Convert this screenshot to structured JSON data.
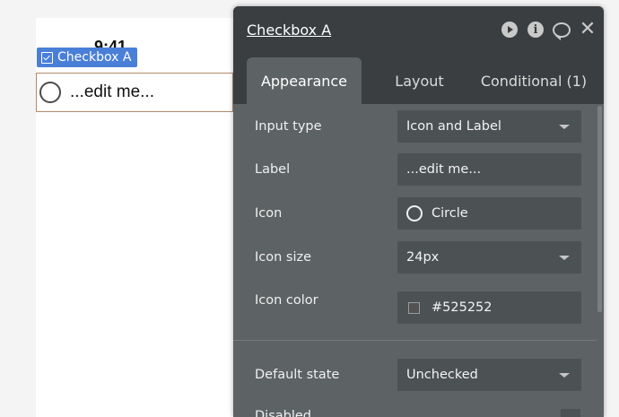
{
  "canvas": {
    "time": "9:41",
    "element_tag": "Checkbox A",
    "checkbox_label": "...edit me..."
  },
  "panel": {
    "title": "Checkbox A",
    "tabs": [
      {
        "label": "Appearance",
        "active": true
      },
      {
        "label": "Layout",
        "active": false
      },
      {
        "label": "Conditional (1)",
        "active": false
      }
    ],
    "fields": {
      "input_type": {
        "label": "Input type",
        "value": "Icon and Label"
      },
      "label": {
        "label": "Label",
        "value": "...edit me..."
      },
      "icon": {
        "label": "Icon",
        "value": "Circle"
      },
      "icon_size": {
        "label": "Icon size",
        "value": "24px"
      },
      "icon_color": {
        "label": "Icon color",
        "value": "#525252"
      },
      "default_state": {
        "label": "Default state",
        "value": "Unchecked"
      },
      "disabled": {
        "label": "Disabled"
      }
    }
  },
  "icons": [
    "checkbox-icon",
    "play-icon",
    "info-icon",
    "comment-icon",
    "close-icon",
    "circle-icon",
    "chevron-down-icon"
  ],
  "colors": {
    "panel_bg": "#5d6264",
    "header_bg": "#3a3e40",
    "tag_bg": "#4a7fd8",
    "swatch": "#525252"
  }
}
